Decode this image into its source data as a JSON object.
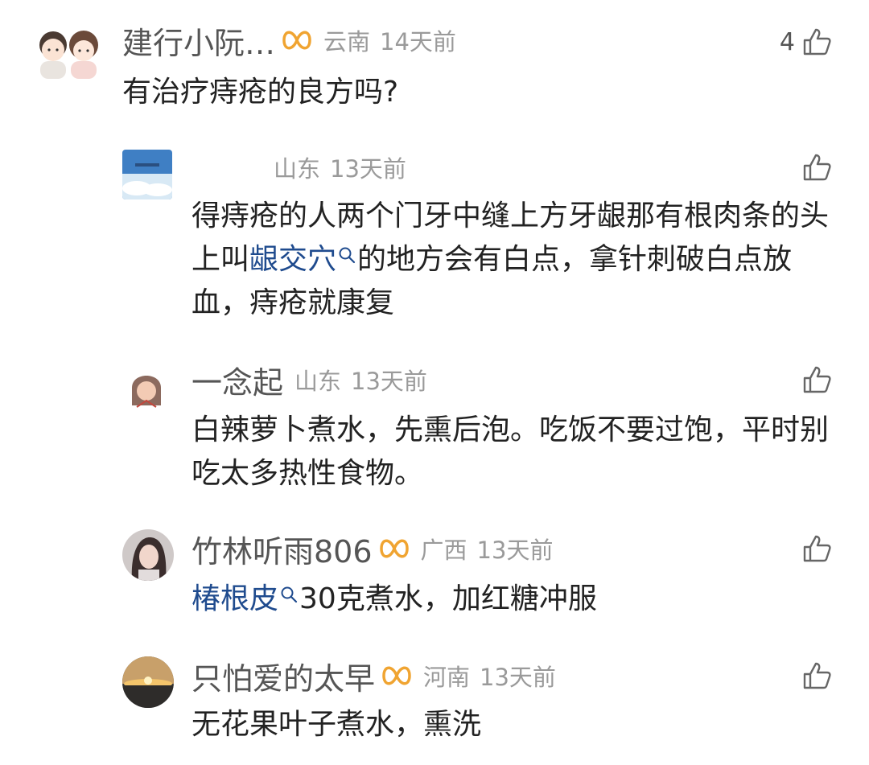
{
  "colors": {
    "text": "#222222",
    "username": "#555555",
    "meta": "#9a9a9a",
    "keyword_link": "#1f4b8e",
    "badge": "#f0a431",
    "background": "#ffffff"
  },
  "comments": [
    {
      "username": "建行小阮…",
      "has_badge": true,
      "location": "云南",
      "time": "14天前",
      "likes": "4",
      "text": "有治疗痔疮的良方吗?"
    },
    {
      "username": "",
      "has_badge": false,
      "location": "山东",
      "time": "13天前",
      "likes": "",
      "text_part1": "得痔疮的人两个门牙中缝上方牙龈那有根肉条的头上叫",
      "keyword": "龈交穴",
      "text_part2": "的地方会有白点，拿针刺破白点放血，痔疮就康复"
    },
    {
      "username": "一念起",
      "has_badge": false,
      "location": "山东",
      "time": "13天前",
      "likes": "",
      "text": "白辣萝卜煮水，先熏后泡。吃饭不要过饱，平时别吃太多热性食物。"
    },
    {
      "username": "竹林听雨806",
      "has_badge": true,
      "location": "广西",
      "time": "13天前",
      "likes": "",
      "keyword": "椿根皮",
      "text_part2": "30克煮水，加红糖冲服"
    },
    {
      "username": "只怕爱的太早",
      "has_badge": true,
      "location": "河南",
      "time": "13天前",
      "likes": "",
      "text": "无花果叶子煮水，熏洗"
    }
  ],
  "icons": {
    "like": "thumbs-up-icon",
    "badge": "infinity-badge-icon",
    "keyword_search": "search-icon"
  }
}
